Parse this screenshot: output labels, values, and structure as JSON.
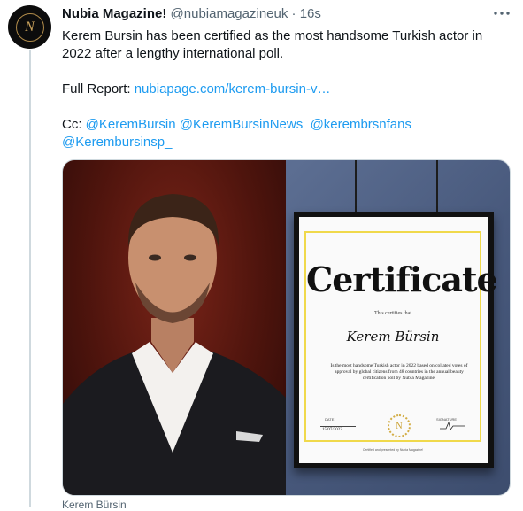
{
  "tweet": {
    "display_name": "Nubia Magazine!",
    "handle": "@nubiamagazineuk",
    "separator": "·",
    "time": "16s",
    "avatar_letter": "N",
    "more_icon": "ellipsis-icon",
    "text_line1": "Kerem Bursin has been certified as the most handsome Turkish actor in 2022 after a lengthy international poll.",
    "full_report_label": "Full Report:",
    "full_report_link": "nubiapage.com/kerem-bursin-v…",
    "cc_label": "Cc:",
    "mentions": [
      "@KeremBursin",
      "@KeremBursinNews",
      "@kerembrsnfans",
      "@Kerembursinsp_"
    ]
  },
  "certificate": {
    "title": "Certificate",
    "subtitle": "This certifies that",
    "name": "Kerem Bürsin",
    "body": "Is the most handsome Turkish actor in 2022 based on collated votes of approval by global citizens from 48 countries in the annual beauty certification poll by Nubia Magazine.",
    "date_label": "DATE",
    "date_value": "15/07/2022",
    "signature_label": "SIGNATURE",
    "seal_letter": "N",
    "footer": "Certified and presented by Nubia Magazine!"
  },
  "media": {
    "caption": "Kerem Bürsin"
  },
  "colors": {
    "link": "#1d9bf0",
    "secondary_text": "#536471",
    "thread_line": "#cfd9de",
    "certificate_border": "#f0d94b"
  }
}
